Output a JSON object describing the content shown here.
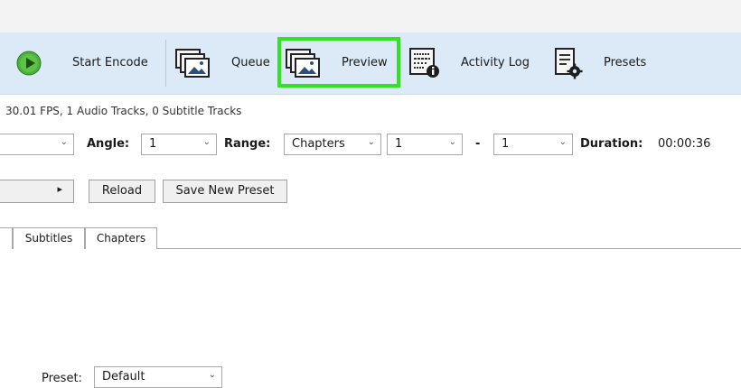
{
  "toolbar": {
    "start_encode": "Start Encode",
    "queue": "Queue",
    "preview": "Preview",
    "activity_log": "Activity Log",
    "presets": "Presets"
  },
  "source_info": "30.01 FPS, 1 Audio Tracks, 0 Subtitle Tracks",
  "range_row": {
    "angle_label": "Angle:",
    "angle_value": "1",
    "range_label": "Range:",
    "range_type": "Chapters",
    "range_start": "1",
    "range_separator": "-",
    "range_end": "1",
    "duration_label": "Duration:",
    "duration_value": "00:00:36"
  },
  "preset_row": {
    "reload": "Reload",
    "save_new_preset": "Save New Preset"
  },
  "tabs": {
    "subtitles": "Subtitles",
    "chapters": "Chapters"
  },
  "bottom": {
    "preset_label": "Preset:",
    "preset_value": "Default"
  },
  "colors": {
    "toolbar_bg": "#dce9f7",
    "highlight": "#2ee620",
    "play_green": "#4caf3a"
  },
  "icons": {
    "start_encode": "play-icon",
    "queue": "image-stack-icon",
    "preview": "image-stack-icon",
    "activity_log": "log-info-icon",
    "presets": "document-gear-icon"
  }
}
